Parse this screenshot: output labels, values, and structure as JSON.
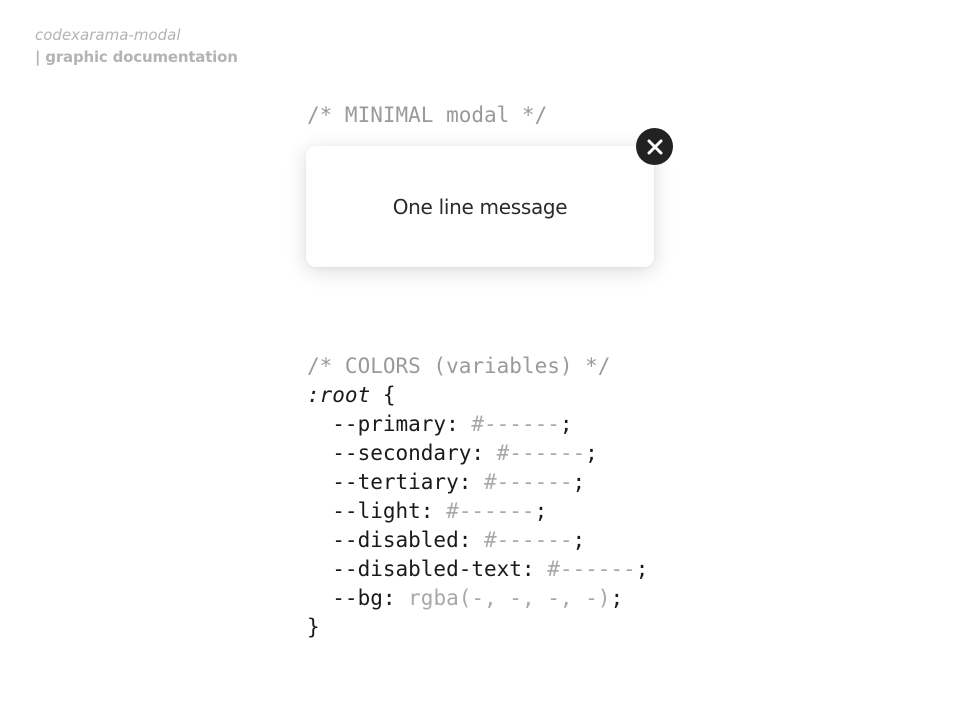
{
  "header": {
    "project": "codexarama-modal",
    "subtitle": "| graphic documentation"
  },
  "minimal_section": {
    "comment": "/* MINIMAL modal */",
    "modal_message": "One line message",
    "close_icon": "close-x-icon",
    "close_button_color": "#222222"
  },
  "colors_section": {
    "comment": "/* COLORS (variables) */",
    "selector": ":root",
    "open_brace": " {",
    "close_brace": "}",
    "variables": [
      {
        "name": "  --primary: ",
        "value": "#------",
        "end": ";"
      },
      {
        "name": "  --secondary: ",
        "value": "#------",
        "end": ";"
      },
      {
        "name": "  --tertiary: ",
        "value": "#------",
        "end": ";"
      },
      {
        "name": "  --light: ",
        "value": "#------",
        "end": ";"
      },
      {
        "name": "  --disabled: ",
        "value": "#------",
        "end": ";"
      },
      {
        "name": "  --disabled-text: ",
        "value": "#------",
        "end": ";"
      },
      {
        "name": "  --bg: ",
        "value": "rgba(-, -, -, -)",
        "end": ";"
      }
    ]
  }
}
